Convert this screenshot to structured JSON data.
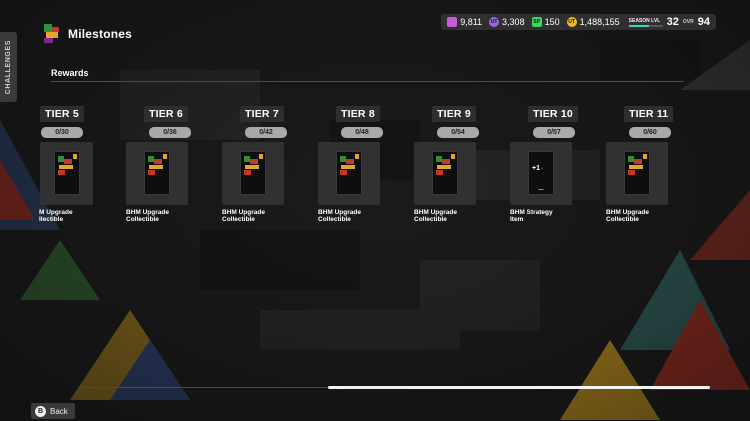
{
  "side_tab": {
    "label": "CHALLENGES"
  },
  "header": {
    "title": "Milestones"
  },
  "currencies": [
    {
      "icon": "points-icon",
      "value": "9,811",
      "color": "#c95bd8"
    },
    {
      "icon": "ut-tokens-icon",
      "value": "3,308",
      "color": "#9a6ae0"
    },
    {
      "icon": "sp-icon",
      "value": "150",
      "color": "#3fd45a"
    },
    {
      "icon": "coins-icon",
      "value": "1,488,155",
      "color": "#f1b72a"
    }
  ],
  "season": {
    "label": "SEASON LVL",
    "level": "32",
    "progress": 0.6,
    "accent": "#3ad3c6"
  },
  "ovr": {
    "label": "OVR",
    "value": "94"
  },
  "section": {
    "label": "Rewards"
  },
  "tiers": [
    {
      "name": "TIER 5",
      "progress": "0/30",
      "reward": "M Upgrade\nllectible",
      "type": "pack"
    },
    {
      "name": "TIER 6",
      "progress": "0/36",
      "reward": "BHM Upgrade\nCollectible",
      "type": "pack"
    },
    {
      "name": "TIER 7",
      "progress": "0/42",
      "reward": "BHM Upgrade\nCollectible",
      "type": "pack"
    },
    {
      "name": "TIER 8",
      "progress": "0/48",
      "reward": "BHM Upgrade\nCollectible",
      "type": "pack"
    },
    {
      "name": "TIER 9",
      "progress": "0/54",
      "reward": "BHM Upgrade\nCollectible",
      "type": "pack"
    },
    {
      "name": "TIER 10",
      "progress": "0/57",
      "reward": "BHM Strategy\nItem",
      "type": "strategy"
    },
    {
      "name": "TIER 11",
      "progress": "0/60",
      "reward": "BHM Upgrade\nCollectible",
      "type": "pack"
    }
  ],
  "back": {
    "button": "B",
    "label": "Back"
  }
}
